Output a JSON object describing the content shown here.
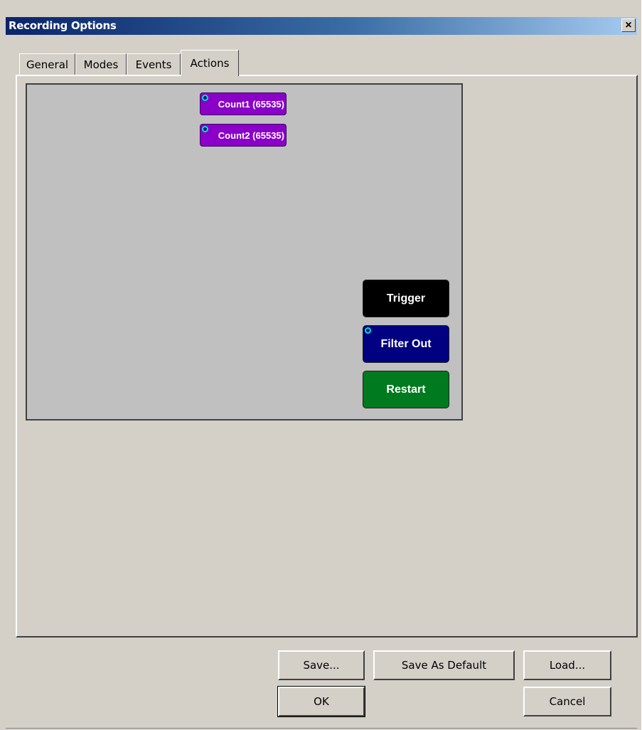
{
  "window": {
    "title": "Recording Options",
    "close_glyph": "×"
  },
  "tabs": [
    {
      "label": "General",
      "active": false
    },
    {
      "label": "Modes",
      "active": false
    },
    {
      "label": "Events",
      "active": false
    },
    {
      "label": "Actions",
      "active": true
    }
  ],
  "canvas": {
    "counters": [
      {
        "label": "Count1 (65535)",
        "color": "#8a00c8"
      },
      {
        "label": "Count2 (65535)",
        "color": "#8a00c8"
      }
    ],
    "actions": [
      {
        "label": "Trigger",
        "color": "#000000",
        "has_icon": false
      },
      {
        "label": "Filter Out",
        "color": "#000080",
        "has_icon": true
      },
      {
        "label": "Restart",
        "color": "#007a1e",
        "has_icon": false
      }
    ],
    "node_icon": "connector-node-icon"
  },
  "buttons": {
    "save": "Save...",
    "save_as_default": "Save As Default",
    "load": "Load...",
    "ok": "OK",
    "cancel": "Cancel"
  },
  "colors": {
    "dialog_bg": "#d4d0c8",
    "canvas_bg": "#c0c0c0",
    "title_gradient_start": "#0a246a",
    "title_gradient_end": "#a6caf0"
  }
}
